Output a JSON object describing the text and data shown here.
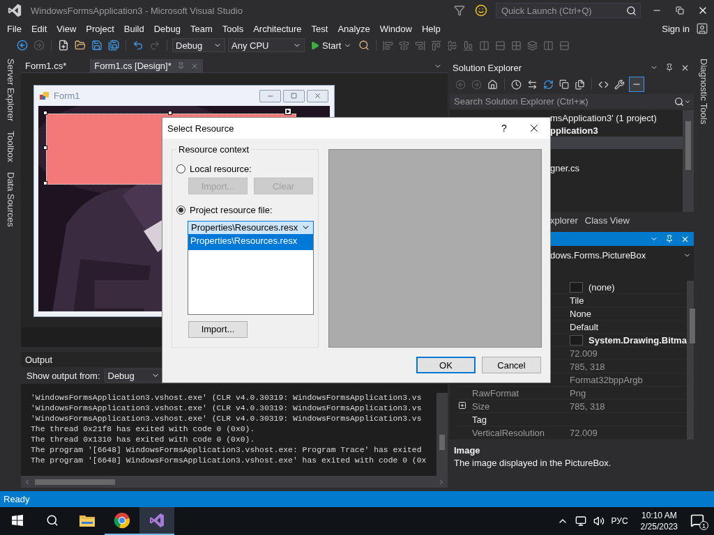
{
  "window": {
    "title": "WindowsFormsApplication3 - Microsoft Visual Studio"
  },
  "quick_launch": {
    "placeholder": "Quick Launch (Ctrl+Q)"
  },
  "menu": [
    "File",
    "Edit",
    "View",
    "Project",
    "Build",
    "Debug",
    "Team",
    "Tools",
    "Architecture",
    "Test",
    "Analyze",
    "Window",
    "Help"
  ],
  "sign_in": "Sign in",
  "toolbar": {
    "configuration": "Debug",
    "platform": "Any CPU",
    "start": "Start"
  },
  "side_tabs_left": [
    "Server Explorer",
    "Toolbox",
    "Data Sources"
  ],
  "side_tabs_right": [
    "Diagnostic Tools"
  ],
  "document_tabs": [
    {
      "label": "Form1.cs*",
      "selected": false
    },
    {
      "label": "Form1.cs [Design]*",
      "selected": true
    }
  ],
  "designer": {
    "form_title": "Form1"
  },
  "output": {
    "title": "Output",
    "source_label": "Show output from:",
    "source": "Debug",
    "lines": [
      "'WindowsFormsApplication3.vshost.exe' (CLR v4.0.30319: WindowsFormsApplication3.vs",
      "'WindowsFormsApplication3.vshost.exe' (CLR v4.0.30319: WindowsFormsApplication3.vs",
      "'WindowsFormsApplication3.vshost.exe' (CLR v4.0.30319: WindowsFormsApplication3.vs",
      "The thread 0x21f8 has exited with code 0 (0x0).",
      "The thread 0x1310 has exited with code 0 (0x0).",
      "The program '[6648] WindowsFormsApplication3.vshost.exe: Program Trace' has exited",
      "The program '[6648] WindowsFormsApplication3.vshost.exe' has exited with code 0 (0x"
    ]
  },
  "solution_explorer": {
    "title": "Solution Explorer",
    "search_placeholder": "Search Solution Explorer (Ctrl+ж)",
    "items": [
      {
        "kind": "solution",
        "label": "msApplication3' (1 project)",
        "selected": false
      },
      {
        "kind": "project",
        "label": "pplication3",
        "selected": false
      },
      {
        "selected": true
      },
      {
        "kind": "file",
        "label": "gner.cs",
        "selected": false
      }
    ]
  },
  "panel_tabs": [
    "xplorer",
    "Class View"
  ],
  "properties": {
    "object": "dows.Forms.PictureBox",
    "rows": [
      {
        "value": "(none)",
        "swatch": true,
        "readonly": false
      },
      {
        "value": "Tile",
        "readonly": false
      },
      {
        "value": "None",
        "readonly": false
      },
      {
        "value": "Default",
        "readonly": false
      },
      {
        "value": "System.Drawing.Bitma",
        "swatch": true,
        "bold": true,
        "readonly": false
      },
      {
        "value": "72.009",
        "readonly": true
      },
      {
        "value": "785, 318",
        "readonly": true
      },
      {
        "value": "Format32bppArgb",
        "readonly": true
      },
      {
        "name": "RawFormat",
        "value": "Png",
        "readonly": true
      },
      {
        "name": "Size",
        "value": "785, 318",
        "readonly": true,
        "expanded": false
      },
      {
        "name": "Tag",
        "readonly": false
      },
      {
        "name": "VerticalResolution",
        "value": "72.009",
        "readonly": true
      }
    ],
    "description_title": "Image",
    "description": "The image displayed in the PictureBox."
  },
  "dialog": {
    "title": "Select Resource",
    "help": "?",
    "group_title": "Resource context",
    "options": [
      {
        "label": "Local resource:",
        "selected": false
      },
      {
        "label": "Project resource file:",
        "selected": true
      }
    ],
    "local_buttons": [
      {
        "label": "Import...",
        "disabled": true
      },
      {
        "label": "Clear",
        "disabled": true
      }
    ],
    "resource_file": "Properties\\Resources.resx",
    "dropdown_items": [
      {
        "label": "Properties\\Resources.resx",
        "selected": true
      }
    ],
    "import_button": "Import...",
    "ok": "OK",
    "cancel": "Cancel"
  },
  "status_bar": {
    "text": "Ready"
  },
  "taskbar": {
    "apps": [
      {
        "kind": "folder",
        "active": false,
        "running": false
      },
      {
        "kind": "browser",
        "active": false,
        "running": true
      },
      {
        "kind": "studio",
        "active": true,
        "running": true
      }
    ],
    "language": "РУС",
    "time": "10:10 AM",
    "date": "2/25/2023",
    "notifications": "1"
  }
}
